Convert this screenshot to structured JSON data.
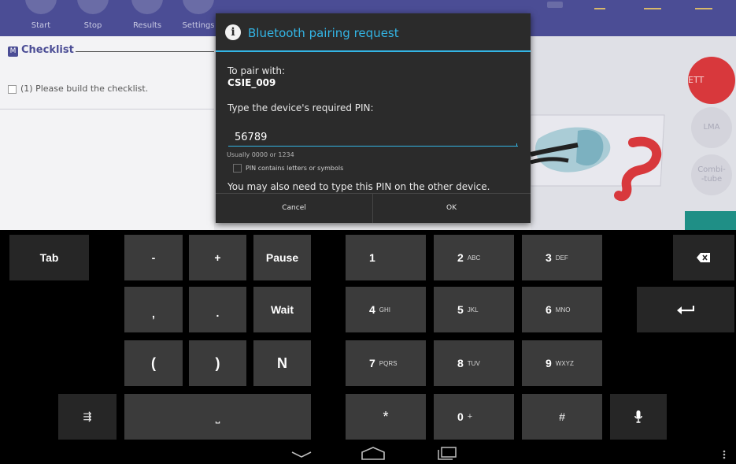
{
  "app": {
    "nav": [
      "Start",
      "Stop",
      "Results",
      "Settings"
    ],
    "checklist": {
      "badge": "M",
      "title": "Checklist",
      "item": "(1) Please build the checklist."
    },
    "side_buttons": {
      "ett": "ETT",
      "lma": "LMA",
      "combi": "Combi-\n-tube"
    }
  },
  "dialog": {
    "title": "Bluetooth pairing request",
    "pair_with_label": "To pair with:",
    "device_name": "CSIE_009",
    "pin_prompt": "Type the device's required PIN:",
    "pin_value": "56789",
    "pin_hint": "Usually 0000 or 1234",
    "pin_letters_label": "PIN contains letters or symbols",
    "also_type": "You may also need to type this PIN on the other device.",
    "cancel_label": "Cancel",
    "ok_label": "OK"
  },
  "keyboard": {
    "tab": "Tab",
    "minus": "-",
    "plus": "+",
    "pause": "Pause",
    "comma": ",",
    "period": ".",
    "wait": "Wait",
    "open_paren": "(",
    "close_paren": ")",
    "n": "N",
    "digits": [
      {
        "d": "1",
        "sub": ""
      },
      {
        "d": "2",
        "sub": "ABC"
      },
      {
        "d": "3",
        "sub": "DEF"
      },
      {
        "d": "4",
        "sub": "GHI"
      },
      {
        "d": "5",
        "sub": "JKL"
      },
      {
        "d": "6",
        "sub": "MNO"
      },
      {
        "d": "7",
        "sub": "PQRS"
      },
      {
        "d": "8",
        "sub": "TUV"
      },
      {
        "d": "9",
        "sub": "WXYZ"
      }
    ],
    "star": "*",
    "zero": "0",
    "zero_sub": "+",
    "hash": "#",
    "space_symbol": "⎵",
    "settings_symbol": "⇶"
  },
  "colors": {
    "accent": "#33b5e5",
    "app_header": "#4b4d95",
    "ett": "#d8383c"
  },
  "icons": [
    "info-icon",
    "backspace-icon",
    "enter-icon",
    "microphone-icon",
    "back-icon",
    "home-icon",
    "recents-icon",
    "menu-icon"
  ]
}
